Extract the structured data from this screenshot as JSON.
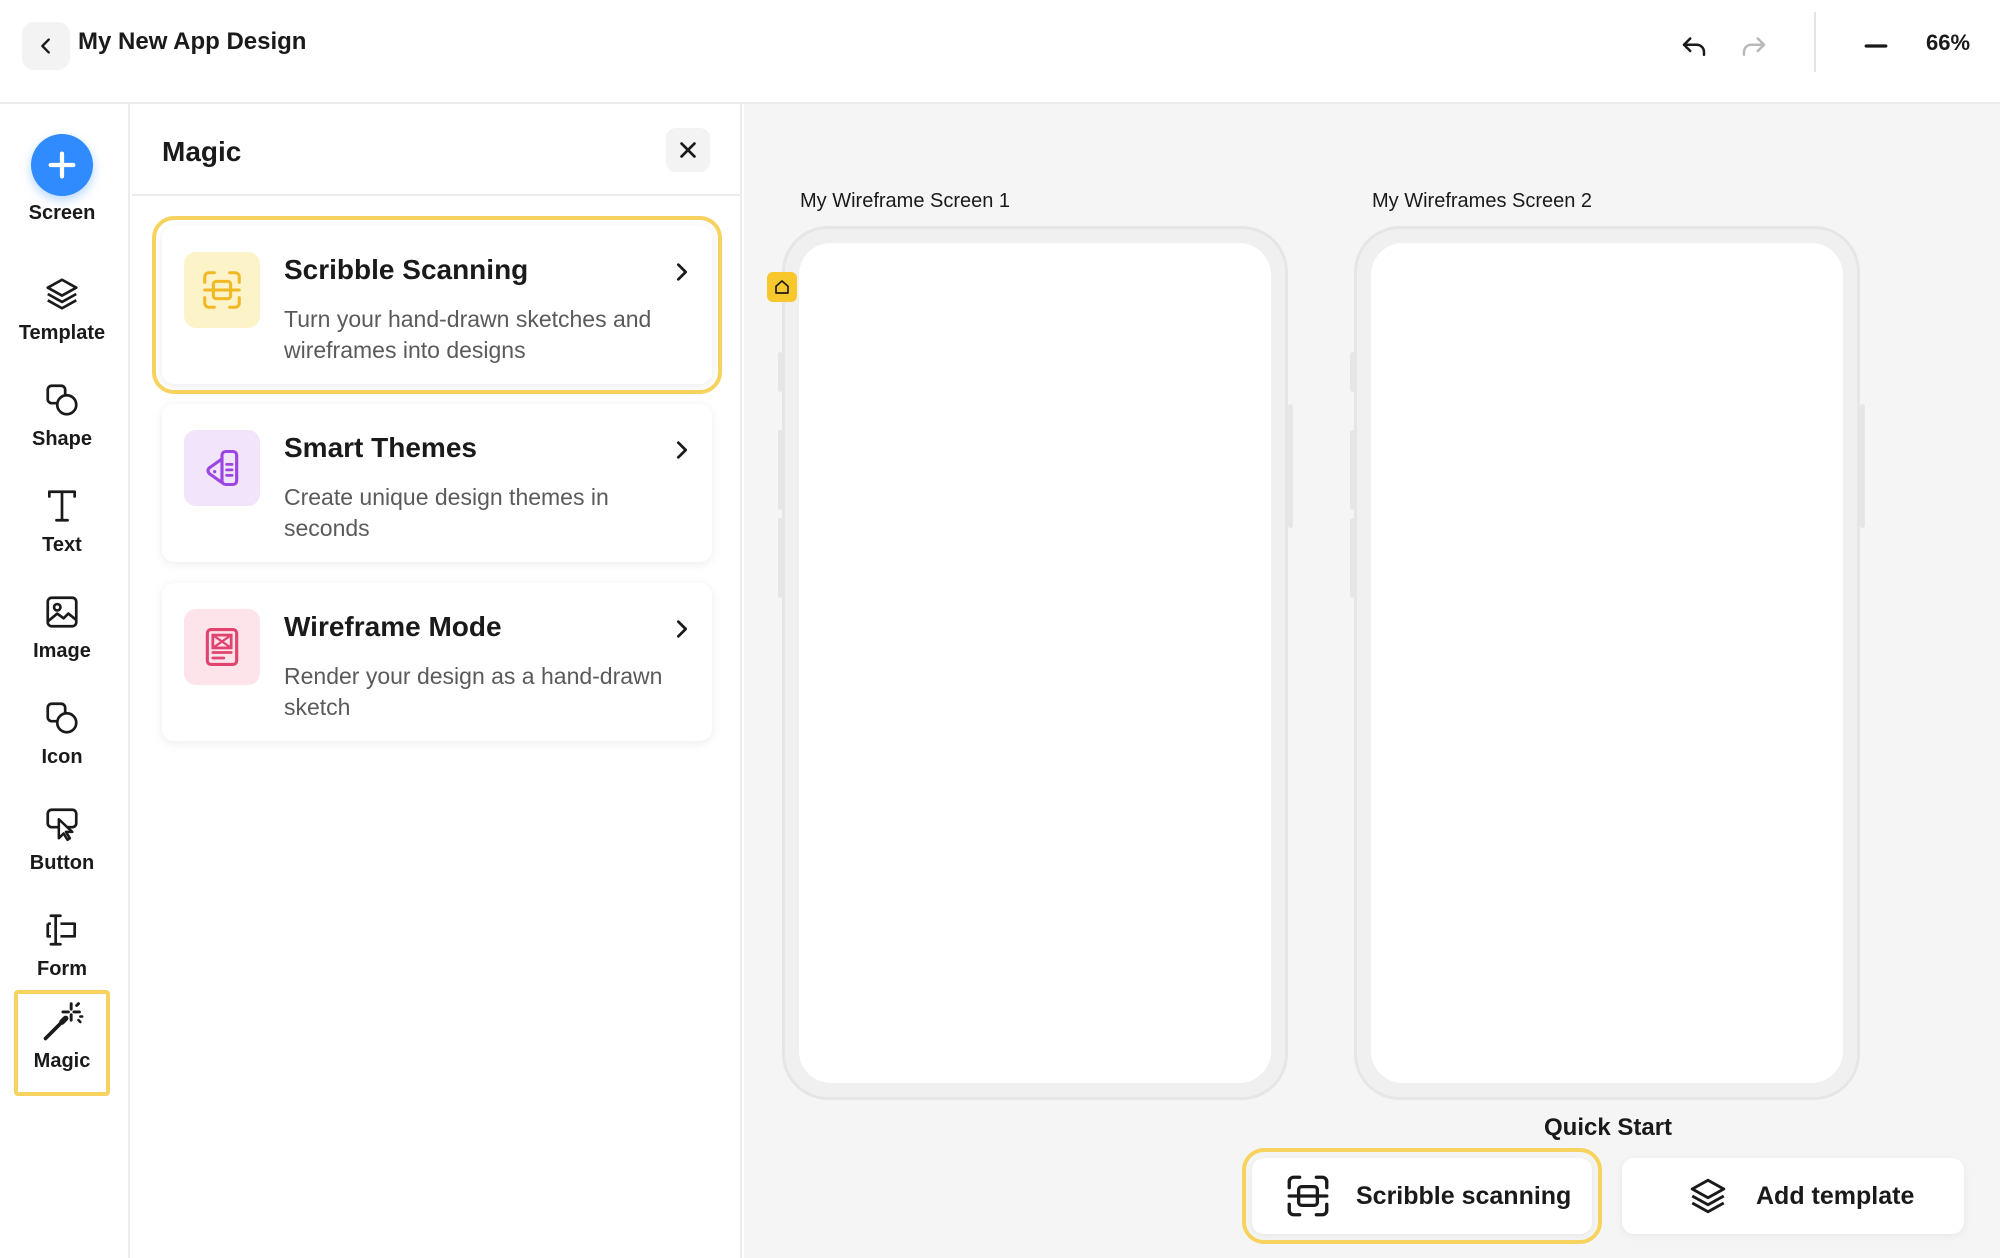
{
  "header": {
    "title": "My New App Design",
    "zoom": "66%",
    "icons": {
      "back": "chevron-left-icon",
      "undo": "undo-icon",
      "redo": "redo-icon",
      "zoom_out": "minus-icon"
    }
  },
  "rail": {
    "items": [
      {
        "label": "Screen",
        "icon": "plus-icon"
      },
      {
        "label": "Template",
        "icon": "layers-icon"
      },
      {
        "label": "Shape",
        "icon": "shape-icon"
      },
      {
        "label": "Text",
        "icon": "text-icon"
      },
      {
        "label": "Image",
        "icon": "image-icon"
      },
      {
        "label": "Icon",
        "icon": "icon-icon"
      },
      {
        "label": "Button",
        "icon": "cursor-button-icon"
      },
      {
        "label": "Form",
        "icon": "form-icon"
      },
      {
        "label": "Magic",
        "icon": "magic-wand-icon",
        "active": true
      }
    ]
  },
  "panel": {
    "title": "Magic",
    "cards": [
      {
        "title": "Scribble Scanning",
        "description": "Turn your hand-drawn sketches and wireframes into designs",
        "icon": "scan-icon",
        "icon_bg": "#fdf3c9",
        "icon_color": "#f2b824"
      },
      {
        "title": "Smart Themes",
        "description": "Create unique design themes in seconds",
        "icon": "palette-icon",
        "icon_bg": "#f1e4fb",
        "icon_color": "#9b46e0"
      },
      {
        "title": "Wireframe Mode",
        "description": "Render your design as a hand-drawn sketch",
        "icon": "wireframe-icon",
        "icon_bg": "#fde3ea",
        "icon_color": "#e0446f"
      }
    ]
  },
  "canvas": {
    "screens": [
      {
        "label": "My Wireframe Screen 1"
      },
      {
        "label": "My Wireframes Screen 2"
      }
    ],
    "quick_start": {
      "title": "Quick Start",
      "buttons": [
        {
          "label": "Scribble scanning",
          "icon": "scan-icon"
        },
        {
          "label": "Add template",
          "icon": "layers-icon"
        }
      ]
    }
  },
  "colors": {
    "accent_blue": "#2f8bff",
    "highlight_yellow": "#f6d35f",
    "home_badge": "#f7c72b"
  }
}
